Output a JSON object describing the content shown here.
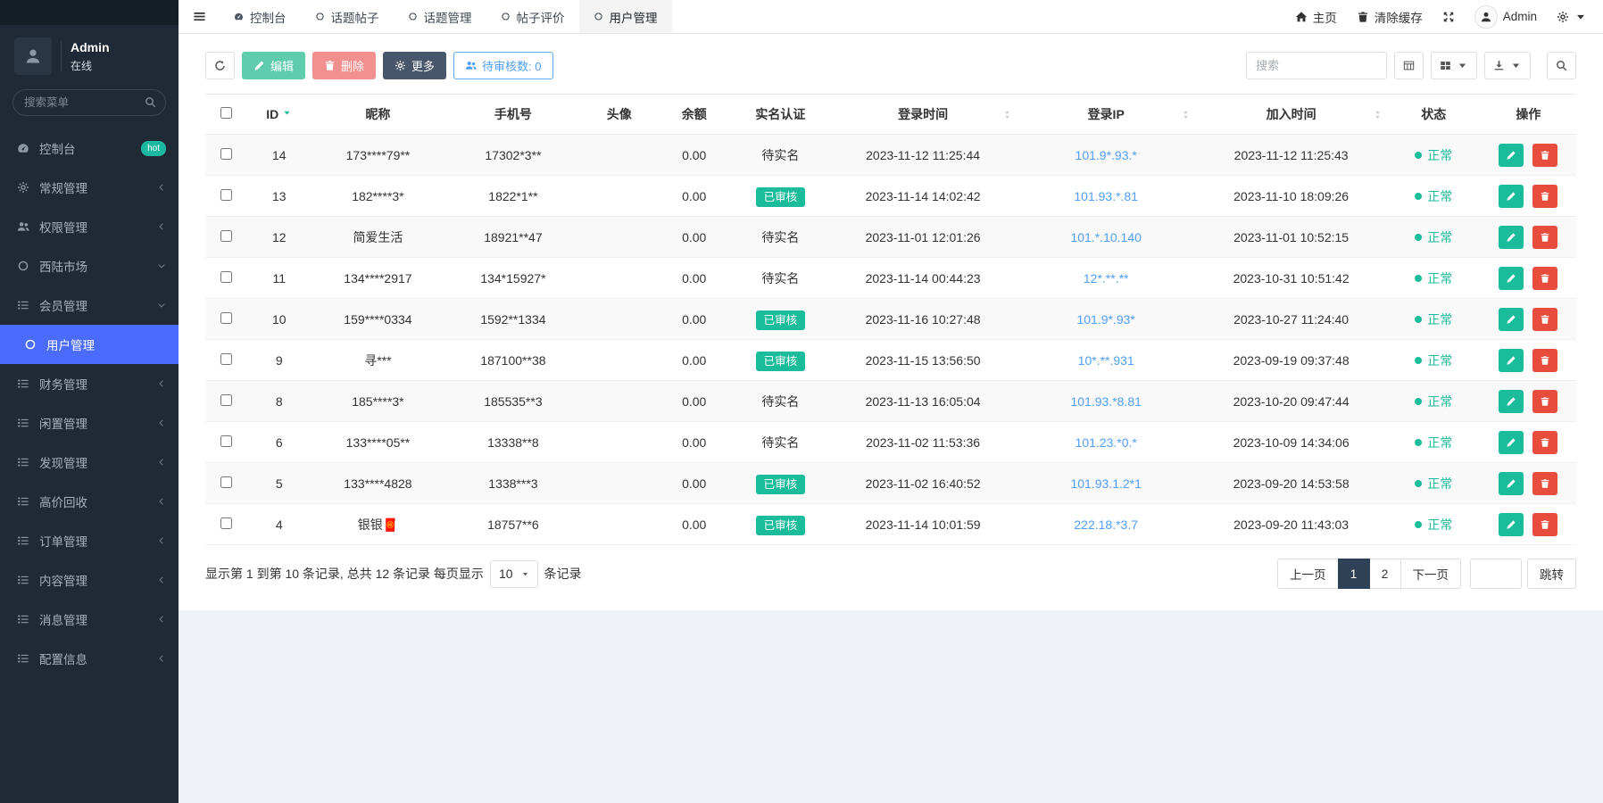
{
  "colors": {
    "accent_blue": "#4a6bfb",
    "teal": "#1abc9c",
    "red": "#e74c3c",
    "link_blue": "#4f9ef7"
  },
  "sidebar": {
    "user": {
      "name": "Admin",
      "status": "在线"
    },
    "search": {
      "placeholder": "搜索菜单"
    },
    "items": [
      {
        "id": "console",
        "label": "控制台",
        "icon": "dashboard-icon",
        "badge": "hot"
      },
      {
        "id": "general",
        "label": "常规管理",
        "icon": "gears-icon",
        "chevron": "left"
      },
      {
        "id": "permissions",
        "label": "权限管理",
        "icon": "users-icon",
        "chevron": "left"
      },
      {
        "id": "market",
        "label": "西陆市场",
        "icon": "circle-icon",
        "chevron": "down"
      },
      {
        "id": "members",
        "label": "会员管理",
        "icon": "list-icon",
        "chevron": "down"
      },
      {
        "id": "users",
        "label": "用户管理",
        "icon": "circle-icon",
        "active": true,
        "sub": true
      },
      {
        "id": "finance",
        "label": "财务管理",
        "icon": "list-icon",
        "chevron": "left"
      },
      {
        "id": "idle",
        "label": "闲置管理",
        "icon": "list-icon",
        "chevron": "left"
      },
      {
        "id": "discover",
        "label": "发现管理",
        "icon": "list-icon",
        "chevron": "left"
      },
      {
        "id": "recycle",
        "label": "高价回收",
        "icon": "list-icon",
        "chevron": "left"
      },
      {
        "id": "orders",
        "label": "订单管理",
        "icon": "list-icon",
        "chevron": "left"
      },
      {
        "id": "content",
        "label": "内容管理",
        "icon": "list-icon",
        "chevron": "left"
      },
      {
        "id": "messages",
        "label": "消息管理",
        "icon": "list-icon",
        "chevron": "left"
      },
      {
        "id": "config",
        "label": "配置信息",
        "icon": "list-icon",
        "chevron": "left"
      }
    ]
  },
  "topbar": {
    "tabs": [
      {
        "id": "console",
        "label": "控制台",
        "icon": "dashboard-icon"
      },
      {
        "id": "topic-posts",
        "label": "话题帖子",
        "icon": "circle-icon"
      },
      {
        "id": "topic-manage",
        "label": "话题管理",
        "icon": "circle-icon"
      },
      {
        "id": "post-review",
        "label": "帖子评价",
        "icon": "circle-icon"
      },
      {
        "id": "user-manage",
        "label": "用户管理",
        "icon": "circle-icon",
        "active": true
      }
    ],
    "actions": {
      "home": "主页",
      "clear_cache": "清除缓存",
      "username": "Admin"
    }
  },
  "toolbar": {
    "edit": "编辑",
    "delete": "删除",
    "more": "更多",
    "pending": "待审核数: 0",
    "search_placeholder": "搜索"
  },
  "table": {
    "columns": [
      {
        "key": "id",
        "label": "ID",
        "sort": "caret"
      },
      {
        "key": "nickname",
        "label": "昵称"
      },
      {
        "key": "phone",
        "label": "手机号"
      },
      {
        "key": "avatar",
        "label": "头像"
      },
      {
        "key": "balance",
        "label": "余额"
      },
      {
        "key": "auth",
        "label": "实名认证"
      },
      {
        "key": "login_time",
        "label": "登录时间",
        "sort": "both"
      },
      {
        "key": "login_ip",
        "label": "登录IP",
        "sort": "both"
      },
      {
        "key": "join_time",
        "label": "加入时间",
        "sort": "both"
      },
      {
        "key": "status",
        "label": "状态"
      },
      {
        "key": "ops",
        "label": "操作"
      }
    ],
    "rows": [
      {
        "id": "14",
        "nickname": "173****79**",
        "phone": "17302*3**",
        "balance": "0.00",
        "auth": "待实名",
        "auth_style": "plain",
        "login_time": "2023-11-12 11:25:44",
        "login_ip": "101.9*.93.*",
        "join_time": "2023-11-12 11:25:43",
        "status": "正常"
      },
      {
        "id": "13",
        "nickname": "182****3*",
        "phone": "1822*1**",
        "balance": "0.00",
        "auth": "已审核",
        "auth_style": "badge",
        "login_time": "2023-11-14 14:02:42",
        "login_ip": "101.93.*.81",
        "join_time": "2023-11-10 18:09:26",
        "status": "正常"
      },
      {
        "id": "12",
        "nickname": "简爱生活",
        "phone": "18921**47",
        "balance": "0.00",
        "auth": "待实名",
        "auth_style": "plain",
        "login_time": "2023-11-01 12:01:26",
        "login_ip": "101.*.10.140",
        "join_time": "2023-11-01 10:52:15",
        "status": "正常"
      },
      {
        "id": "11",
        "nickname": "134****2917",
        "phone": "134*15927*",
        "balance": "0.00",
        "auth": "待实名",
        "auth_style": "plain",
        "login_time": "2023-11-14 00:44:23",
        "login_ip": "12*.**.**",
        "join_time": "2023-10-31 10:51:42",
        "status": "正常"
      },
      {
        "id": "10",
        "nickname": "159****0334",
        "phone": "1592**1334",
        "balance": "0.00",
        "auth": "已审核",
        "auth_style": "badge",
        "login_time": "2023-11-16 10:27:48",
        "login_ip": "101.9*.93*",
        "join_time": "2023-10-27 11:24:40",
        "status": "正常"
      },
      {
        "id": "9",
        "nickname": "寻***",
        "phone": "187100**38",
        "balance": "0.00",
        "auth": "已审核",
        "auth_style": "badge",
        "login_time": "2023-11-15 13:56:50",
        "login_ip": "10*.**.931",
        "join_time": "2023-09-19 09:37:48",
        "status": "正常"
      },
      {
        "id": "8",
        "nickname": "185****3*",
        "phone": "185535**3",
        "balance": "0.00",
        "auth": "待实名",
        "auth_style": "plain",
        "login_time": "2023-11-13 16:05:04",
        "login_ip": "101.93.*8.81",
        "join_time": "2023-10-20 09:47:44",
        "status": "正常"
      },
      {
        "id": "6",
        "nickname": "133****05**",
        "phone": "13338**8",
        "balance": "0.00",
        "auth": "待实名",
        "auth_style": "plain",
        "login_time": "2023-11-02 11:53:36",
        "login_ip": "101.23.*0.*",
        "join_time": "2023-10-09 14:34:06",
        "status": "正常"
      },
      {
        "id": "5",
        "nickname": "133****4828",
        "phone": "1338***3",
        "balance": "0.00",
        "auth": "已审核",
        "auth_style": "badge",
        "login_time": "2023-11-02 16:40:52",
        "login_ip": "101.93.1.2*1",
        "join_time": "2023-09-20 14:53:58",
        "status": "正常"
      },
      {
        "id": "4",
        "nickname": "银银🧧",
        "phone": "18757**6",
        "balance": "0.00",
        "auth": "已审核",
        "auth_style": "badge",
        "login_time": "2023-11-14 10:01:59",
        "login_ip": "222.18.*3.7",
        "join_time": "2023-09-20 11:43:03",
        "status": "正常"
      }
    ]
  },
  "footer": {
    "info_prefix": "显示第 1 到第 10 条记录, 总共 12 条记录 每页显示",
    "page_size": "10",
    "info_suffix": "条记录",
    "prev": "上一页",
    "pages": [
      "1",
      "2"
    ],
    "active_page": "1",
    "next": "下一页",
    "jump": "跳转"
  }
}
